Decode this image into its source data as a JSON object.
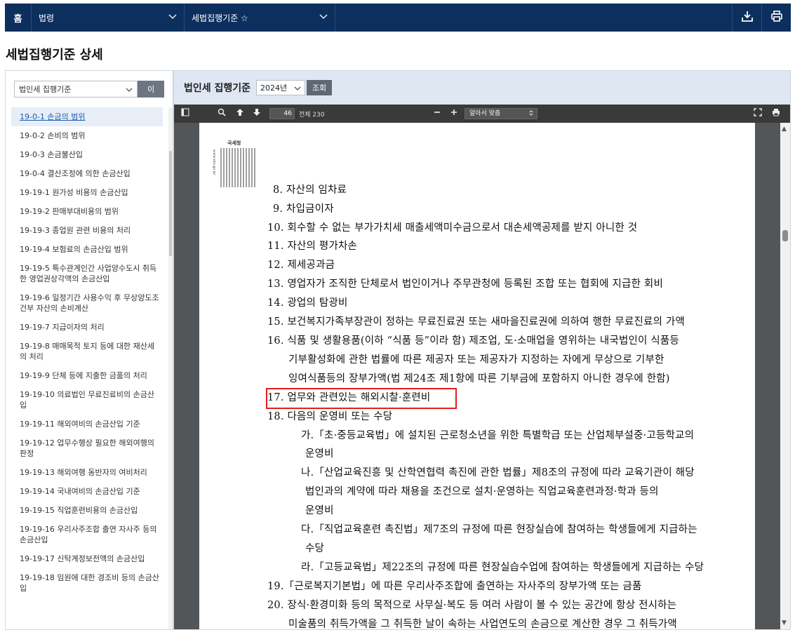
{
  "topbar": {
    "home": "홈",
    "menu1": "법령",
    "menu2": "세법집행기준 ☆",
    "download_icon": "download-icon",
    "print_icon": "print-icon"
  },
  "page_title": "세법집행기준 상세",
  "left": {
    "select_value": "법인세 집행기준",
    "select_button": "이",
    "items": [
      "19-0-1 손금의 범위",
      "19-0-2 손비의 범위",
      "19-0-3 손금불산입",
      "19-0-4 결산조정에 의한 손금산입",
      "19-19-1 원가성 비용의 손금산입",
      "19-19-2 판매부대비용의 범위",
      "19-19-3 종업원 관련 비용의 처리",
      "19-19-4 보험료의 손금산입 범위",
      "19-19-5 특수관계인간 사업양수도시 취득한 영업권상각액의 손금산입",
      "19-19-6 일정기간 사용수익 후 무상양도조건부 자산의 손비계산",
      "19-19-7 지급이자의 처리",
      "19-19-8 매매목적 토지 등에 대한 재산세의 처리",
      "19-19-9 단체 등에 지출한 금품의 처리",
      "19-19-10 의료법인 무료진료비의 손금산입",
      "19-19-11 해외여비의 손금산입 기준",
      "19-19-12 업무수행상 필요한 해외여행의 판정",
      "19-19-13 해외여행 동반자의 여비처리",
      "19-19-14 국내여비의 손금산입 기준",
      "19-19-15 직업훈련비용의 손금산입",
      "19-19-16 우리사주조합 출연 자사주 등의 손금산입",
      "19-19-17 신탁계정보전액의 손금산입",
      "19-19-18 임원에 대한 경조비 등의 손금산입"
    ]
  },
  "right": {
    "title": "법인세 집행기준",
    "year": "2024년",
    "query_button": "조회",
    "pdf": {
      "page": "46",
      "page_total": "전체 230",
      "zoom": "알아서 맞춤",
      "qr_brand": "국세청",
      "qr_side": "www.nts.go.kr",
      "lines": [
        "8. 자산의 임차료",
        "9. 차입금이자",
        "10. 회수할 수 없는 부가가치세 매출세액미수금으로서 대손세액공제를 받지 아니한 것",
        "11. 자산의 평가차손",
        "12. 제세공과금",
        "13. 영업자가 조직한 단체로서 법인이거나 주무관청에 등록된 조합 또는 협회에 지급한 회비",
        "14. 광업의 탐광비",
        "15. 보건복지가족부장관이 정하는 무료진료권 또는 새마을진료권에 의하여 행한 무료진료의 가액",
        "16. 식품 및 생활용품(이하 “식품 등”이라 함) 제조업, 도·소매업을 영위하는 내국법인이 식품등",
        "기부활성화에 관한 법률에 따른 제공자 또는 제공자가 지정하는 자에게 무상으로 기부한",
        "잉여식품등의 장부가액(법 제24조 제1항에 따른 기부금에 포함하지 아니한 경우에 한함)",
        "17. 업무와 관련있는 해외시찰·훈련비",
        "18. 다음의 운영비 또는 수당",
        "가.「초·중등교육법」에 설치된 근로청소년을 위한 특별학급 또는 산업체부설중·고등학교의",
        "운영비",
        "나.「산업교육진흥 및 산학연협력 촉진에 관한 법률」제8조의 규정에 따라 교육기관이 해당",
        "법인과의 계약에 따라 채용을 조건으로 설치·운영하는 직업교육훈련과정·학과 등의",
        "운영비",
        "다.「직업교육훈련 촉진법」제7조의 규정에 따른 현장실습에 참여하는 학생들에게 지급하는",
        "수당",
        "라.「고등교육법」제22조의 규정에 따른 현장실습수업에 참여하는 학생들에게 지급하는 수당",
        "19.「근로복지기본법」에 따른 우리사주조합에 출연하는 자사주의 장부가액 또는 금품",
        "20. 장식·환경미화 등의 목적으로 사무실·복도 등 여러 사람이 볼 수 있는 공간에 항상 전시하는",
        "미술품의 취득가액을 그 취득한 날이 속하는 사업연도의 손금으로 계산한 경우 그 취득가액"
      ]
    }
  }
}
